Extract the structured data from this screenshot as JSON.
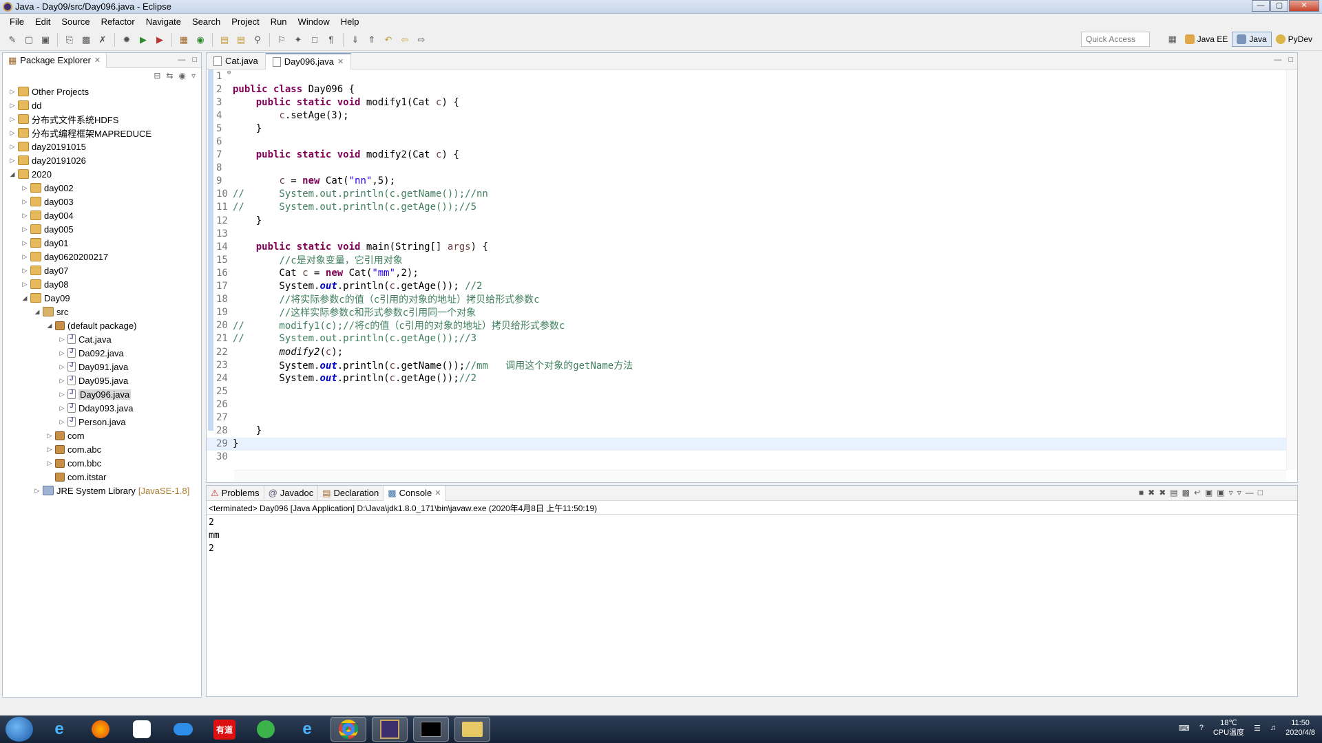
{
  "window": {
    "title": "Java - Day09/src/Day096.java - Eclipse"
  },
  "menu": [
    "File",
    "Edit",
    "Source",
    "Refactor",
    "Navigate",
    "Search",
    "Project",
    "Run",
    "Window",
    "Help"
  ],
  "toolbar": {
    "quick_access": "Quick Access",
    "perspectives": [
      {
        "label": "Java EE",
        "active": false
      },
      {
        "label": "Java",
        "active": true
      },
      {
        "label": "PyDev",
        "active": false
      }
    ]
  },
  "package_explorer": {
    "title": "Package Explorer",
    "tree": [
      {
        "label": "Other Projects",
        "indent": 0,
        "icon": "proj",
        "state": "collapsed"
      },
      {
        "label": "dd",
        "indent": 0,
        "icon": "proj",
        "state": "collapsed"
      },
      {
        "label": "分布式文件系统HDFS",
        "indent": 0,
        "icon": "proj",
        "state": "collapsed"
      },
      {
        "label": "分布式编程框架MAPREDUCE",
        "indent": 0,
        "icon": "proj",
        "state": "collapsed"
      },
      {
        "label": "day20191015",
        "indent": 0,
        "icon": "proj",
        "state": "collapsed"
      },
      {
        "label": "day20191026",
        "indent": 0,
        "icon": "proj",
        "state": "collapsed"
      },
      {
        "label": "2020",
        "indent": 0,
        "icon": "proj",
        "state": "expanded"
      },
      {
        "label": "day002",
        "indent": 1,
        "icon": "proj",
        "state": "collapsed"
      },
      {
        "label": "day003",
        "indent": 1,
        "icon": "proj",
        "state": "collapsed"
      },
      {
        "label": "day004",
        "indent": 1,
        "icon": "proj",
        "state": "collapsed"
      },
      {
        "label": "day005",
        "indent": 1,
        "icon": "proj",
        "state": "collapsed"
      },
      {
        "label": "day01",
        "indent": 1,
        "icon": "proj",
        "state": "collapsed"
      },
      {
        "label": "day0620200217",
        "indent": 1,
        "icon": "proj",
        "state": "collapsed"
      },
      {
        "label": "day07",
        "indent": 1,
        "icon": "proj",
        "state": "collapsed"
      },
      {
        "label": "day08",
        "indent": 1,
        "icon": "proj",
        "state": "collapsed"
      },
      {
        "label": "Day09",
        "indent": 1,
        "icon": "proj",
        "state": "expanded"
      },
      {
        "label": "src",
        "indent": 2,
        "icon": "src",
        "state": "expanded"
      },
      {
        "label": "(default package)",
        "indent": 3,
        "icon": "pkg",
        "state": "expanded"
      },
      {
        "label": "Cat.java",
        "indent": 4,
        "icon": "file",
        "state": "collapsed"
      },
      {
        "label": "Da092.java",
        "indent": 4,
        "icon": "file",
        "state": "collapsed"
      },
      {
        "label": "Day091.java",
        "indent": 4,
        "icon": "file",
        "state": "collapsed"
      },
      {
        "label": "Day095.java",
        "indent": 4,
        "icon": "file",
        "state": "collapsed"
      },
      {
        "label": "Day096.java",
        "indent": 4,
        "icon": "file",
        "state": "collapsed",
        "selected": true
      },
      {
        "label": "Dday093.java",
        "indent": 4,
        "icon": "file",
        "state": "collapsed"
      },
      {
        "label": "Person.java",
        "indent": 4,
        "icon": "file",
        "state": "collapsed"
      },
      {
        "label": "com",
        "indent": 3,
        "icon": "pkg",
        "state": "collapsed"
      },
      {
        "label": "com.abc",
        "indent": 3,
        "icon": "pkg",
        "state": "collapsed"
      },
      {
        "label": "com.bbc",
        "indent": 3,
        "icon": "pkg",
        "state": "collapsed"
      },
      {
        "label": "com.itstar",
        "indent": 3,
        "icon": "pkg",
        "state": "none"
      },
      {
        "label": "JRE System Library",
        "suffix": "[JavaSE-1.8]",
        "indent": 2,
        "icon": "lib",
        "state": "collapsed"
      }
    ]
  },
  "editor": {
    "tabs": [
      {
        "label": "Cat.java",
        "active": false
      },
      {
        "label": "Day096.java",
        "active": true
      }
    ],
    "current_line": 29,
    "lines": [
      {
        "n": 1,
        "fold": false,
        "segs": []
      },
      {
        "n": 2,
        "fold": false,
        "segs": [
          [
            "kw",
            "public class "
          ],
          [
            "p",
            "Day096 {"
          ]
        ]
      },
      {
        "n": 3,
        "fold": true,
        "segs": [
          [
            "p",
            "    "
          ],
          [
            "kw",
            "public static void "
          ],
          [
            "p",
            "modify1(Cat "
          ],
          [
            "param",
            "c"
          ],
          [
            "p",
            ") {"
          ]
        ]
      },
      {
        "n": 4,
        "fold": false,
        "segs": [
          [
            "p",
            "        "
          ],
          [
            "param",
            "c"
          ],
          [
            "p",
            ".setAge(3);"
          ]
        ]
      },
      {
        "n": 5,
        "fold": false,
        "segs": [
          [
            "p",
            "    }"
          ]
        ]
      },
      {
        "n": 6,
        "fold": false,
        "segs": []
      },
      {
        "n": 7,
        "fold": true,
        "segs": [
          [
            "p",
            "    "
          ],
          [
            "kw",
            "public static void "
          ],
          [
            "p",
            "modify2(Cat "
          ],
          [
            "param",
            "c"
          ],
          [
            "p",
            ") {"
          ]
        ]
      },
      {
        "n": 8,
        "fold": false,
        "segs": []
      },
      {
        "n": 9,
        "fold": false,
        "segs": [
          [
            "p",
            "        "
          ],
          [
            "param",
            "c"
          ],
          [
            "p",
            " = "
          ],
          [
            "kw",
            "new "
          ],
          [
            "p",
            "Cat("
          ],
          [
            "str",
            "\"nn\""
          ],
          [
            "p",
            ",5);"
          ]
        ]
      },
      {
        "n": 10,
        "fold": false,
        "segs": [
          [
            "cm",
            "//      System.out.println(c.getName());//nn"
          ]
        ]
      },
      {
        "n": 11,
        "fold": false,
        "segs": [
          [
            "cm",
            "//      System.out.println(c.getAge());//5"
          ]
        ]
      },
      {
        "n": 12,
        "fold": false,
        "segs": [
          [
            "p",
            "    }"
          ]
        ]
      },
      {
        "n": 13,
        "fold": false,
        "segs": []
      },
      {
        "n": 14,
        "fold": true,
        "segs": [
          [
            "p",
            "    "
          ],
          [
            "kw",
            "public static void "
          ],
          [
            "p",
            "main(String[] "
          ],
          [
            "param",
            "args"
          ],
          [
            "p",
            ") {"
          ]
        ]
      },
      {
        "n": 15,
        "fold": false,
        "segs": [
          [
            "p",
            "        "
          ],
          [
            "cm",
            "//c是对象变量，它引用对象"
          ]
        ]
      },
      {
        "n": 16,
        "fold": false,
        "segs": [
          [
            "p",
            "        Cat "
          ],
          [
            "param",
            "c"
          ],
          [
            "p",
            " = "
          ],
          [
            "kw",
            "new "
          ],
          [
            "p",
            "Cat("
          ],
          [
            "str",
            "\"mm\""
          ],
          [
            "p",
            ",2);"
          ]
        ]
      },
      {
        "n": 17,
        "fold": false,
        "segs": [
          [
            "p",
            "        System."
          ],
          [
            "fld",
            "out"
          ],
          [
            "p",
            ".println("
          ],
          [
            "param",
            "c"
          ],
          [
            "p",
            ".getAge()); "
          ],
          [
            "cm",
            "//2"
          ]
        ]
      },
      {
        "n": 18,
        "fold": false,
        "segs": [
          [
            "p",
            "        "
          ],
          [
            "cm",
            "//将实际参数c的值（c引用的对象的地址）拷贝给形式参数c"
          ]
        ]
      },
      {
        "n": 19,
        "fold": false,
        "segs": [
          [
            "p",
            "        "
          ],
          [
            "cm",
            "//这样实际参数c和形式参数c引用同一个对象"
          ]
        ]
      },
      {
        "n": 20,
        "fold": false,
        "segs": [
          [
            "cm",
            "//      modify1(c);//将c的值（c引用的对象的地址）拷贝给形式参数c"
          ]
        ]
      },
      {
        "n": 21,
        "fold": false,
        "segs": [
          [
            "cm",
            "//      System.out.println(c.getAge());//3"
          ]
        ]
      },
      {
        "n": 22,
        "fold": false,
        "segs": [
          [
            "p",
            "        "
          ],
          [
            "it",
            "modify2"
          ],
          [
            "p",
            "("
          ],
          [
            "param",
            "c"
          ],
          [
            "p",
            ");"
          ]
        ]
      },
      {
        "n": 23,
        "fold": false,
        "segs": [
          [
            "p",
            "        System."
          ],
          [
            "fld",
            "out"
          ],
          [
            "p",
            ".println("
          ],
          [
            "param",
            "c"
          ],
          [
            "p",
            ".getName());"
          ],
          [
            "cm",
            "//mm   调用这个对象的getName方法"
          ]
        ]
      },
      {
        "n": 24,
        "fold": false,
        "segs": [
          [
            "p",
            "        System."
          ],
          [
            "fld",
            "out"
          ],
          [
            "p",
            ".println("
          ],
          [
            "param",
            "c"
          ],
          [
            "p",
            ".getAge());"
          ],
          [
            "cm",
            "//2"
          ]
        ]
      },
      {
        "n": 25,
        "fold": false,
        "segs": []
      },
      {
        "n": 26,
        "fold": false,
        "segs": []
      },
      {
        "n": 27,
        "fold": false,
        "segs": []
      },
      {
        "n": 28,
        "fold": false,
        "segs": [
          [
            "p",
            "    }"
          ]
        ]
      },
      {
        "n": 29,
        "fold": false,
        "segs": [
          [
            "p",
            "}"
          ]
        ]
      },
      {
        "n": 30,
        "fold": false,
        "segs": []
      }
    ]
  },
  "bottom_panel": {
    "tabs": [
      {
        "label": "Problems",
        "active": false
      },
      {
        "label": "Javadoc",
        "active": false
      },
      {
        "label": "Declaration",
        "active": false
      },
      {
        "label": "Console",
        "active": true
      }
    ],
    "status": "<terminated> Day096 [Java Application] D:\\Java\\jdk1.8.0_171\\bin\\javaw.exe (2020年4月8日 上午11:50:19)",
    "output": [
      "2",
      "mm",
      "2"
    ]
  },
  "taskbar": {
    "apps": [
      "ie",
      "firefox",
      "app",
      "cloud",
      "有道",
      "green",
      "ie2",
      "chrome",
      "eclipse",
      "cmd",
      "folder"
    ],
    "youdao_label": "有道",
    "temp": "18℃",
    "temp_label": "CPU温度",
    "time": "11:50",
    "date": "2020/4/8"
  },
  "colors": {
    "keyword": "#7f0055",
    "comment": "#3f7f5f",
    "string": "#2a00ff",
    "field": "#0000c0",
    "param": "#6a3e3e"
  }
}
